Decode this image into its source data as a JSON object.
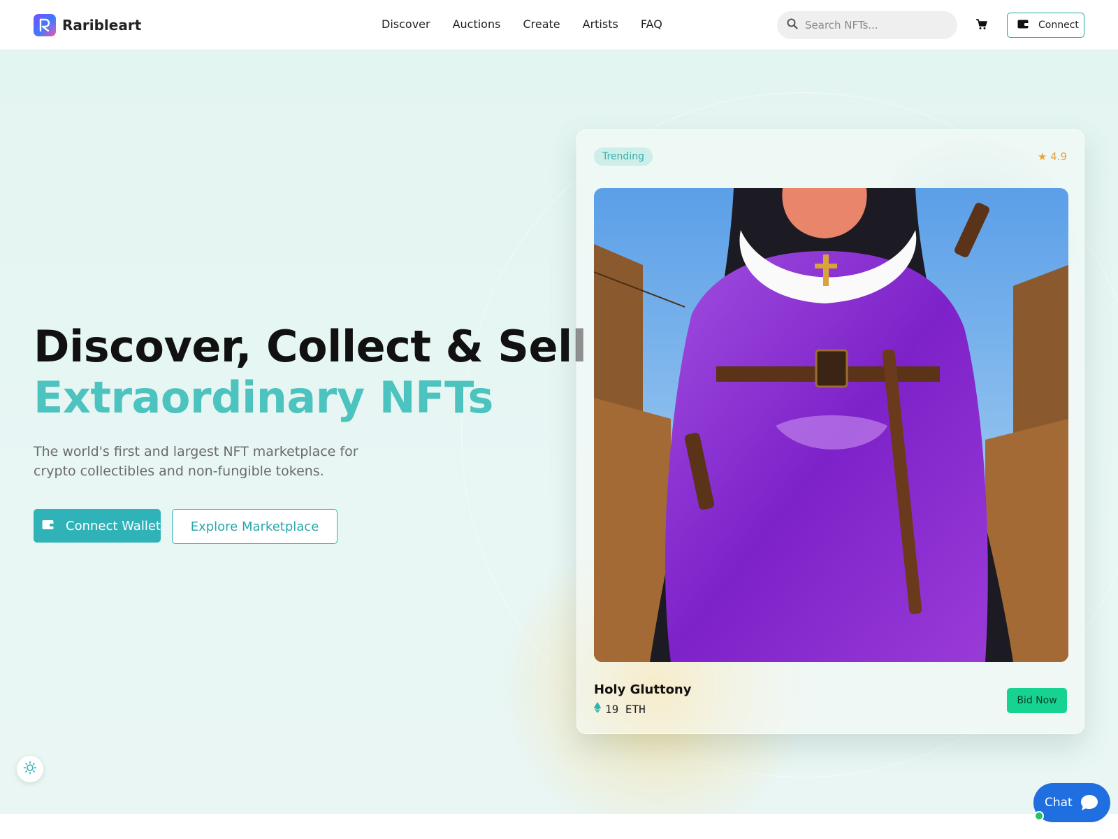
{
  "brand": {
    "name": "Raribleart",
    "logo_letter": "R"
  },
  "nav": {
    "items": [
      {
        "label": "Discover"
      },
      {
        "label": "Auctions"
      },
      {
        "label": "Create"
      },
      {
        "label": "Artists"
      },
      {
        "label": "FAQ"
      }
    ]
  },
  "search": {
    "placeholder": "Search NFTs...",
    "value": ""
  },
  "header": {
    "connect_label": "Connect"
  },
  "hero": {
    "title_line1": "Discover, Collect & Sell",
    "title_line2": "Extraordinary NFTs",
    "subtitle": "The world's first and largest NFT marketplace for crypto collectibles and non-fungible tokens.",
    "primary_button": "Connect Wallet",
    "secondary_button": "Explore Marketplace"
  },
  "featured": {
    "badge": "Trending",
    "rating": "★ 4.9",
    "title": "Holy Gluttony",
    "price": "19 ETH",
    "bid_label": "Bid Now"
  },
  "chat": {
    "label": "Chat"
  },
  "colors": {
    "accent": "#2fb3b8",
    "accent_text": "#4cc3bf",
    "bid": "#17d392",
    "chat": "#1f6fe0",
    "rating": "#e7a23a"
  },
  "icons": {
    "search": "search-icon",
    "cart": "cart-icon",
    "wallet": "wallet-icon",
    "eth": "ethereum-icon",
    "theme": "sun-icon",
    "chat": "chat-bubble-icon"
  }
}
